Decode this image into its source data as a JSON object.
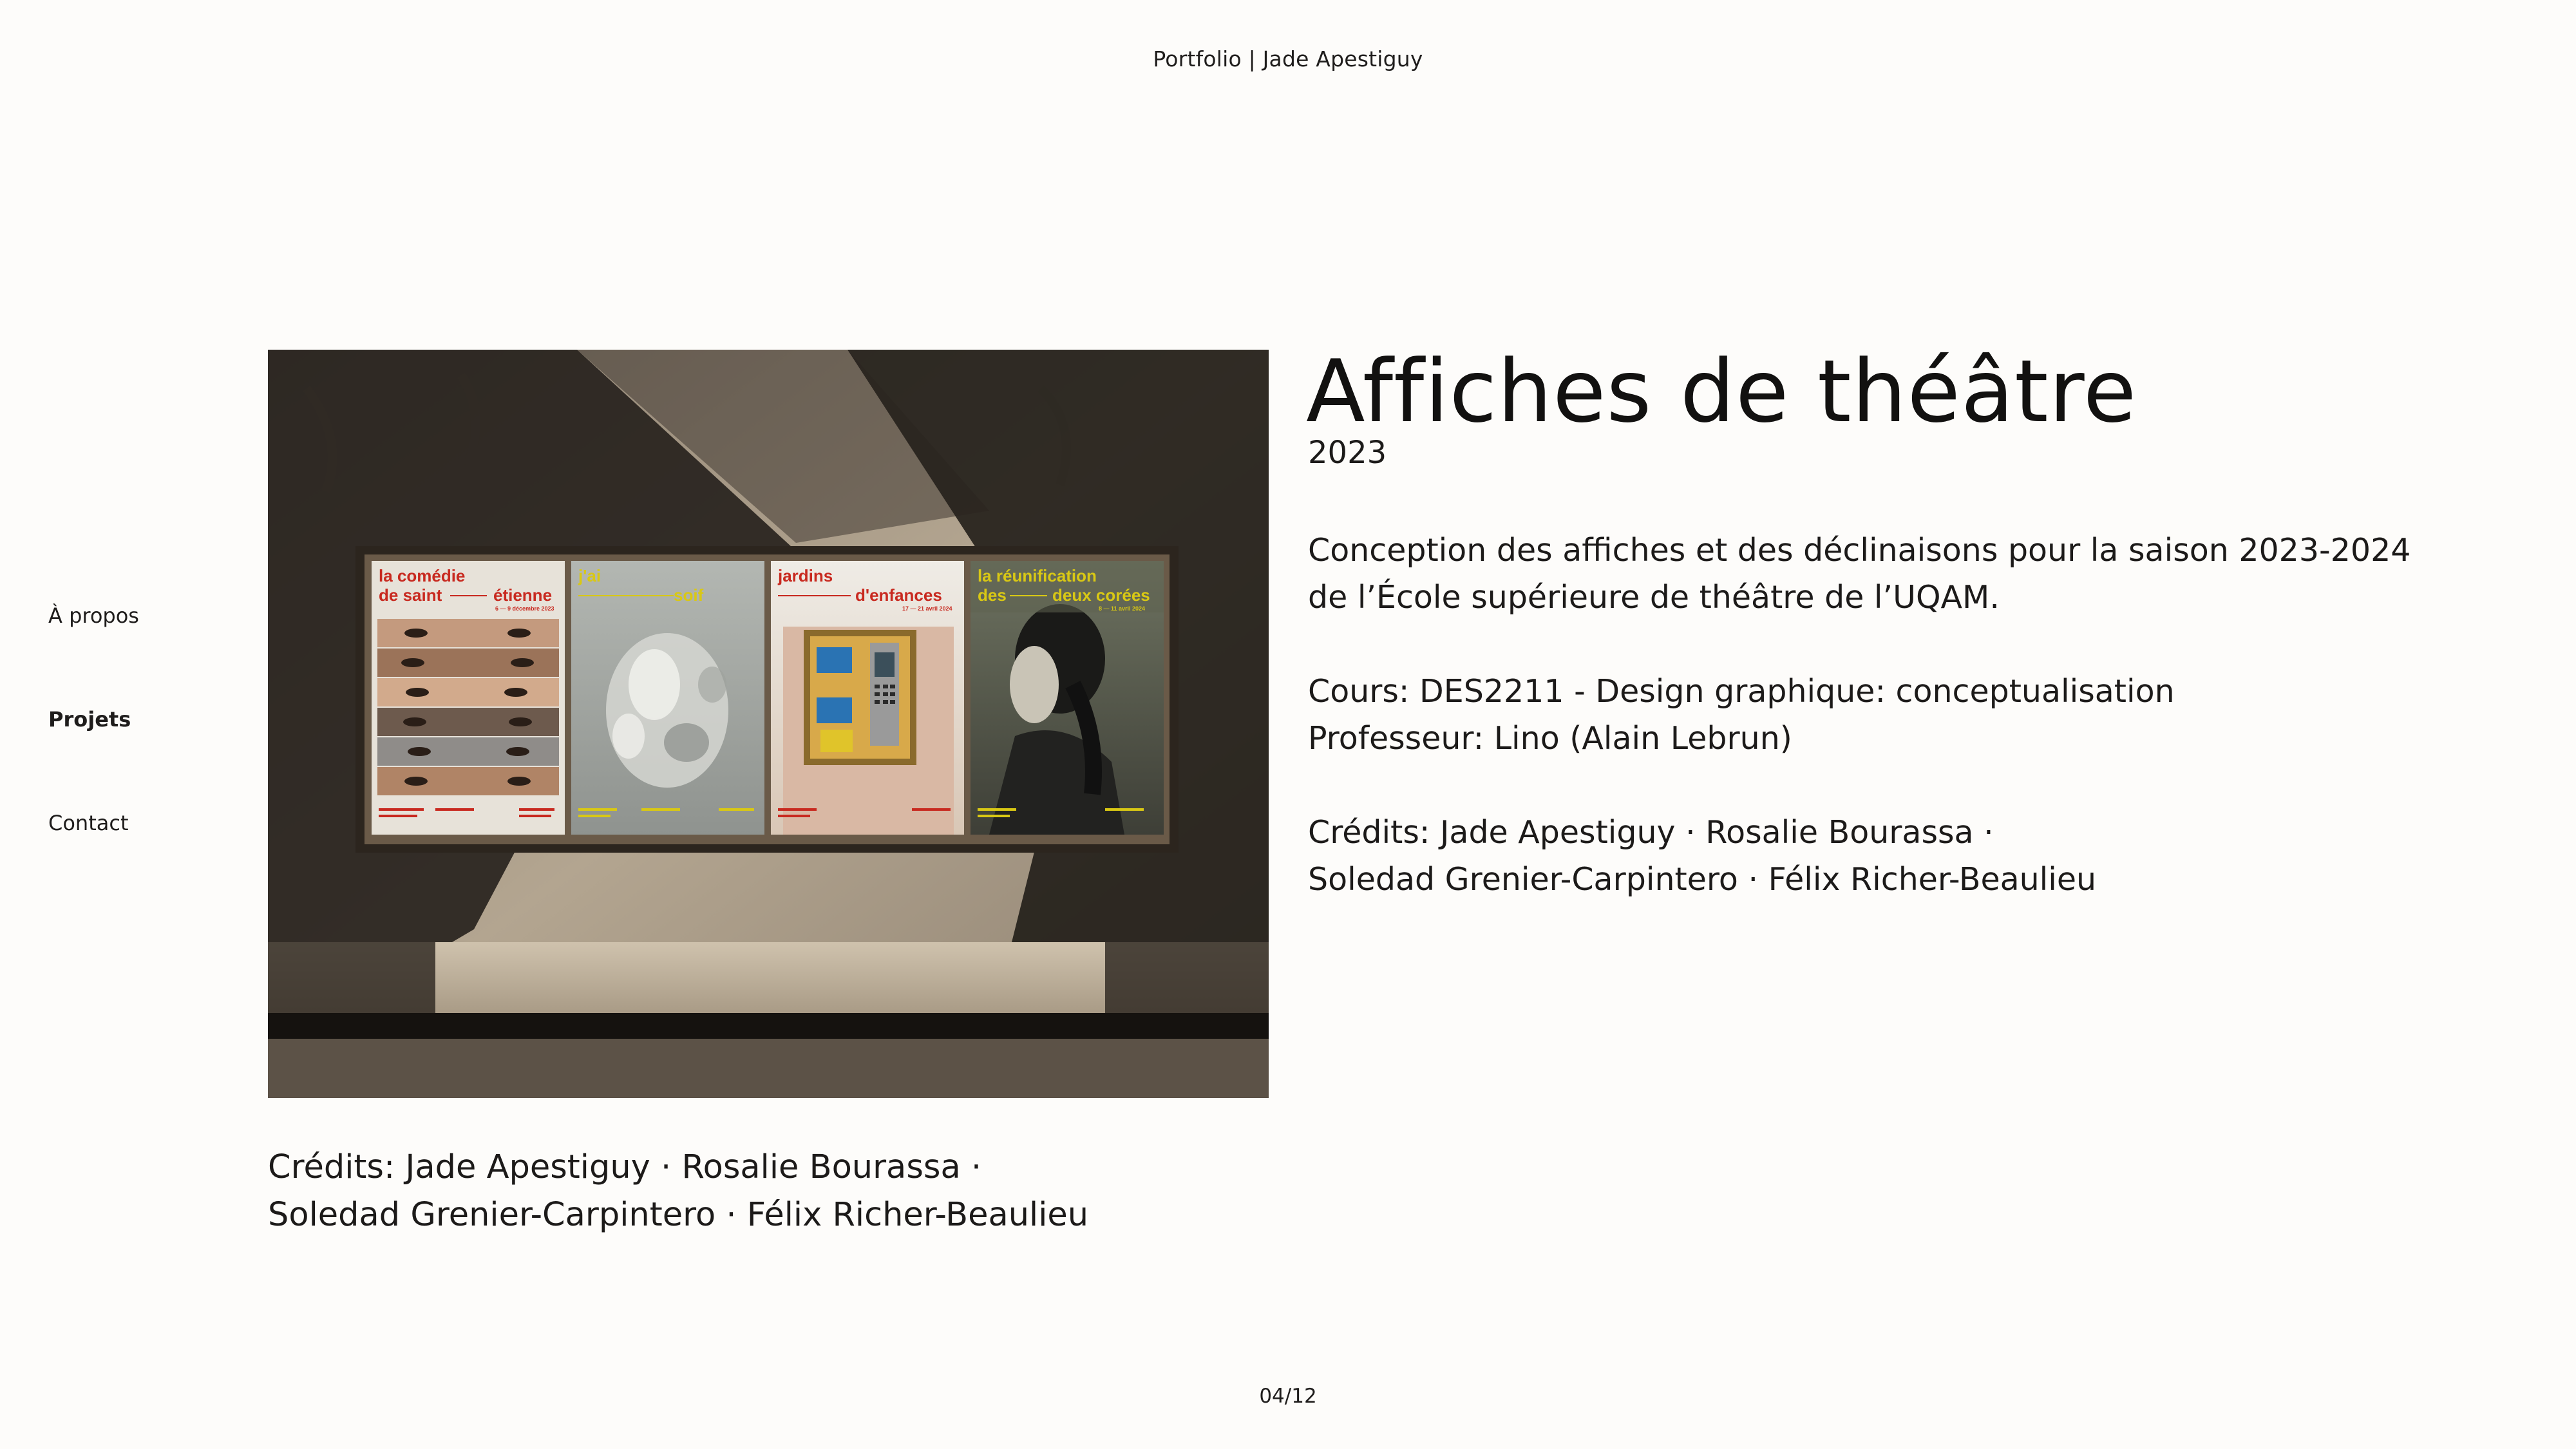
{
  "header": {
    "site_title": "Portfolio | Jade Apestiguy"
  },
  "nav": {
    "items": [
      {
        "label": "À propos",
        "active": false
      },
      {
        "label": "Projets",
        "active": true
      },
      {
        "label": "Contact",
        "active": false
      }
    ]
  },
  "hero_image": {
    "posters": [
      {
        "line1": "la comédie",
        "line2a": "de saint",
        "line2b": "étienne",
        "date": "6 — 9 décembre 2023",
        "color": "#c8291f"
      },
      {
        "line1": "j'ai",
        "line2b": "soif",
        "color": "#d9c814"
      },
      {
        "line1": "jardins",
        "line2b": "d'enfances",
        "date": "17 — 21 avril 2024",
        "color": "#c8291f"
      },
      {
        "line1": "la réunification",
        "line2a": "des",
        "line2b": "deux corées",
        "date": "8 — 11 avril 2024",
        "color": "#d9c814"
      }
    ]
  },
  "project": {
    "title": "Affiches de théâtre",
    "year": "2023",
    "description_lines": [
      "Conception des affiches et des déclinaisons pour la saison 2023-2024",
      "de l’École supérieure de théâtre de l’UQAM."
    ],
    "course": "Cours: DES2211 - Design graphique: conceptualisation",
    "professor": "Professeur: Lino (Alain Lebrun)",
    "credits_lines": [
      "Crédits: Jade Apestiguy · Rosalie Bourassa ·",
      "Soledad Grenier-Carpintero · Félix Richer-Beaulieu"
    ]
  },
  "caption": {
    "lines": [
      "Crédits: Jade Apestiguy · Rosalie Bourassa ·",
      "Soledad Grenier-Carpintero · Félix Richer-Beaulieu"
    ]
  },
  "pagination": {
    "counter": "04/12"
  },
  "colors": {
    "background": "#fdfcfa",
    "text": "#1c1a19",
    "poster_red": "#c8291f",
    "poster_yellow": "#d9c814"
  }
}
